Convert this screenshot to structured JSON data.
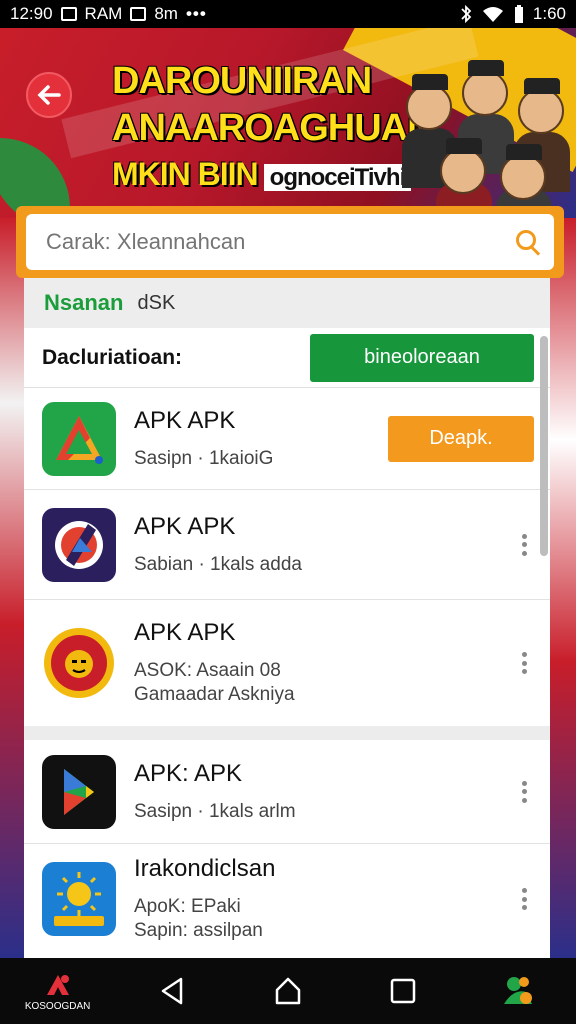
{
  "status_bar": {
    "time_left": "12:90",
    "carrier": "RAM",
    "extra": "8m",
    "dots": "•••",
    "time_right": "1:60"
  },
  "banner": {
    "title_line1": "DAROUNIIRAN",
    "title_line2": "ANAAROAGHUAN",
    "sub_strong": "MKIN BIIN",
    "sub_inner": "ognoceiTivhi",
    "accent_red": "#c81e2a",
    "accent_yellow": "#ffde1a"
  },
  "search": {
    "placeholder": "Carak: Xleannahcan",
    "accent": "#f29a1c"
  },
  "tabs": {
    "brand": "Nsanan",
    "label": "dSK"
  },
  "filter": {
    "label": "Dacluriatioan:",
    "button_label": "bineoloreaan",
    "button_color": "#17963c"
  },
  "apps": [
    {
      "name": "APK APK",
      "sub_line1": "Sasipn · 1kaioiG",
      "sub_line2": "",
      "action": "Deapk.",
      "action_type": "button",
      "icon": "triangle-logo-icon"
    },
    {
      "name": "APK APK",
      "sub_line1": "Sabian · 1kals adda",
      "sub_line2": "",
      "action_type": "more",
      "icon": "circle-logo-icon"
    },
    {
      "name": "APK APK",
      "sub_line1": "ASOK: Asaain 08",
      "sub_line2": "Gamaadar Askniya",
      "action_type": "more",
      "icon": "mask-emblem-icon"
    },
    {
      "name": "APK: APK",
      "sub_line1": "Sasipn · 1kals arlm",
      "sub_line2": "",
      "action_type": "more",
      "icon": "play-store-icon"
    },
    {
      "name": "Irakondiclsan",
      "sub_line1": "ApoK: EPaki",
      "sub_line2": "Sapin: assilpan",
      "action_type": "more",
      "icon": "sun-badge-icon"
    }
  ],
  "nav": {
    "brand_label": "KOSOOGDAN",
    "items": [
      "brand-icon",
      "back-icon",
      "home-icon",
      "recents-icon",
      "assistant-icon"
    ]
  }
}
